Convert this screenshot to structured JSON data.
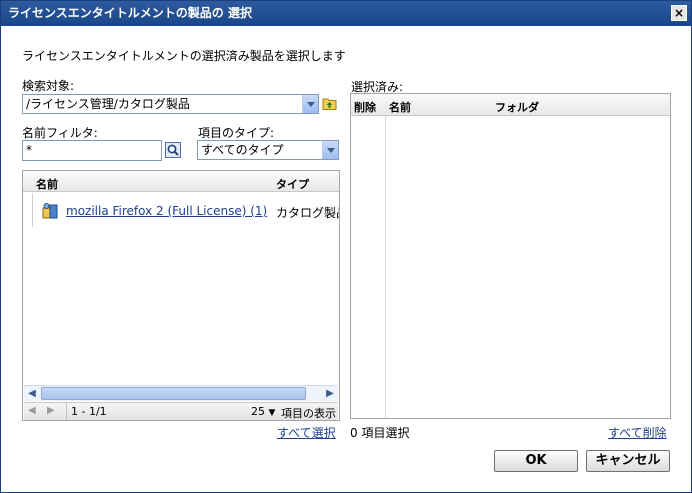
{
  "window": {
    "title": "ライセンスエンタイトルメントの製品の 選択",
    "close_label": "×"
  },
  "instruction": "ライセンスエンタイトルメントの選択済み製品を選択します",
  "search_target": {
    "label": "検索対象:",
    "value": "/ライセンス管理/カタログ製品"
  },
  "name_filter": {
    "label": "名前フィルタ:",
    "value": "*"
  },
  "item_type": {
    "label": "項目のタイプ:",
    "value": "すべてのタイプ"
  },
  "results": {
    "columns": [
      "名前",
      "タイプ"
    ],
    "rows": [
      {
        "name": "mozilla Firefox 2 (Full License) (1)",
        "type": "カタログ製品"
      }
    ],
    "pager": {
      "range": "1 - 1/1",
      "page_size": "25",
      "page_size_label": "項目の表示"
    },
    "select_all": "すべて選択"
  },
  "selected": {
    "label": "選択済み:",
    "columns": [
      "削除",
      "名前",
      "フォルダ"
    ],
    "count_text": "0 項目選択",
    "remove_all": "すべて削除"
  },
  "buttons": {
    "ok": "OK",
    "cancel": "キャンセル"
  },
  "colors": {
    "titlebar": "#1f4b8f",
    "link": "#1e3f8a"
  }
}
